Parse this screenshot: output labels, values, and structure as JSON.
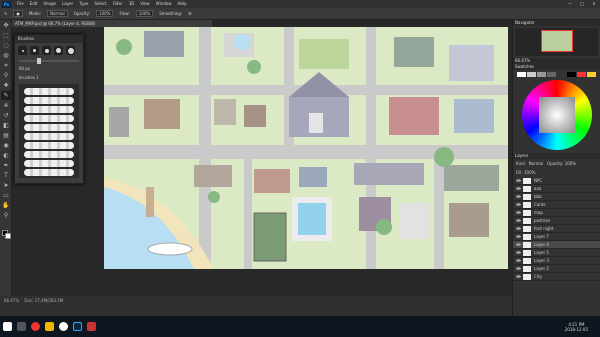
{
  "menubar": {
    "logo": "Ps",
    "items": [
      "File",
      "Edit",
      "Image",
      "Layer",
      "Type",
      "Select",
      "Filter",
      "3D",
      "View",
      "Window",
      "Help"
    ],
    "window_controls": [
      "—",
      "□",
      "✕"
    ]
  },
  "options": {
    "mode_label": "Mode:",
    "mode_value": "Normal",
    "opacity_label": "Opacity:",
    "opacity_value": "100%",
    "flow_label": "Flow:",
    "flow_value": "100%",
    "smoothing_label": "Smoothing:"
  },
  "document": {
    "tab_title": "ATM_MAP.psd @ 66.7% (Layer 4, RGB/8)"
  },
  "brush_panel": {
    "title": "Brushes",
    "size_value": "60 px",
    "folder_label": "brushes 1"
  },
  "status": {
    "zoom": "66.67%",
    "doc_info": "Doc: 17.4M/283.5M"
  },
  "right_panels": {
    "navigator_tab": "Navigator",
    "navigator_zoom": "66.67%",
    "swatches_tab": "Swatches",
    "layers_tab": "Layers",
    "layer_kind": "Kind",
    "blend_mode": "Normal",
    "opacity_label": "Opacity:",
    "opacity_value": "100%",
    "fill_label": "Fill:",
    "fill_value": "100%",
    "layers": [
      "NPC",
      "aaa",
      "bbb",
      "Cards",
      "map",
      "pastries",
      "font night",
      "Layer 7",
      "Layer 4",
      "Layer 5",
      "Layer 3",
      "Layer 2",
      "City"
    ],
    "selected_layer": "Layer 4"
  },
  "taskbar": {
    "time": "4:21 PM",
    "date": "2018-12-05"
  },
  "colors": {
    "accent": "#31a8ff",
    "map_grass": "#cfe2b0",
    "map_road": "#b8b8b8",
    "water": "#9fd3ee",
    "sand": "#efdca5"
  }
}
